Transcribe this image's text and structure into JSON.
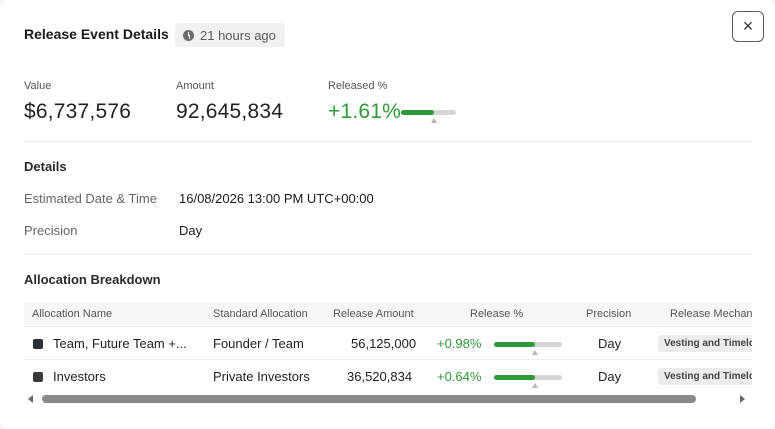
{
  "header": {
    "title": "Release Event Details",
    "time_badge": "21 hours ago",
    "close_label": "×"
  },
  "metrics": {
    "value_label": "Value",
    "value": "$6,737,576",
    "amount_label": "Amount",
    "amount": "92,645,834",
    "released_label": "Released %",
    "released": "+1.61%",
    "released_fill_fraction": 0.6,
    "released_marker_fraction": 0.6
  },
  "details": {
    "title": "Details",
    "date_label": "Estimated Date & Time",
    "date_value": "16/08/2026 13:00 PM UTC+00:00",
    "precision_label": "Precision",
    "precision_value": "Day"
  },
  "allocation": {
    "title": "Allocation Breakdown",
    "columns": [
      "Allocation Name",
      "Standard Allocation",
      "Release Amount",
      "Release %",
      "Precision",
      "Release Mechanism"
    ],
    "rows": [
      {
        "name": "Team, Future Team +...",
        "standard": "Founder / Team",
        "amount": "56,125,000",
        "release_pct": "+0.98%",
        "fill_fraction": 0.6,
        "precision": "Day",
        "mechanism": "Vesting and Timelock",
        "color": "#2b2f3a"
      },
      {
        "name": "Investors",
        "standard": "Private Investors",
        "amount": "36,520,834",
        "release_pct": "+0.64%",
        "fill_fraction": 0.6,
        "precision": "Day",
        "mechanism": "Vesting and Timelock",
        "color": "#3a3a3a"
      }
    ]
  },
  "colors": {
    "accent_green": "#2e9a3a",
    "bar_track": "#d6d6d6"
  }
}
